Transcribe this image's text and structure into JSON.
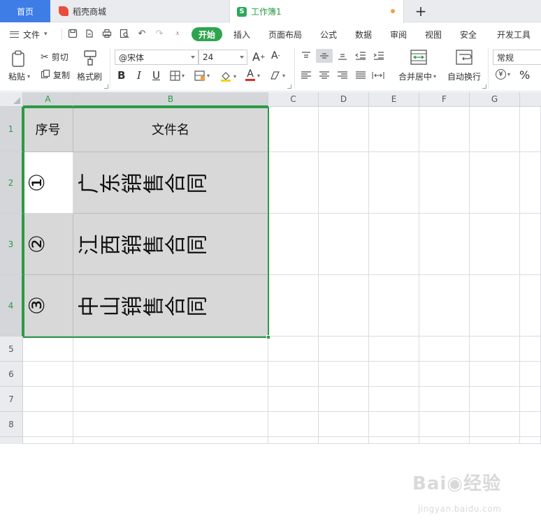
{
  "tabs": {
    "home": "首页",
    "store": "稻壳商城",
    "workbook": "工作簿1",
    "add": "+"
  },
  "menu": {
    "file": "文件",
    "items": [
      "开始",
      "插入",
      "页面布局",
      "公式",
      "数据",
      "审阅",
      "视图",
      "安全",
      "开发工具"
    ]
  },
  "ribbon": {
    "paste": "粘贴",
    "cut": "剪切",
    "copy": "复制",
    "format_painter": "格式刷",
    "font_name": "@宋体",
    "font_size": "24",
    "merge_center": "合并居中",
    "wrap_text": "自动换行",
    "number_format": "常规",
    "percent": "%"
  },
  "grid": {
    "columns": [
      "A",
      "B",
      "C",
      "D",
      "E",
      "F",
      "G"
    ],
    "rows": [
      "1",
      "2",
      "3",
      "4",
      "5",
      "6",
      "7",
      "8"
    ],
    "header_row": {
      "a": "序号",
      "b": "文件名"
    },
    "data_rows": [
      {
        "num": "①",
        "name": "广东销售合同"
      },
      {
        "num": "②",
        "name": "江西销售合同"
      },
      {
        "num": "③",
        "name": "中山销售合同"
      }
    ]
  },
  "watermark": {
    "main": "Bai◉经验",
    "sub": "jingyan.baidu.com"
  }
}
